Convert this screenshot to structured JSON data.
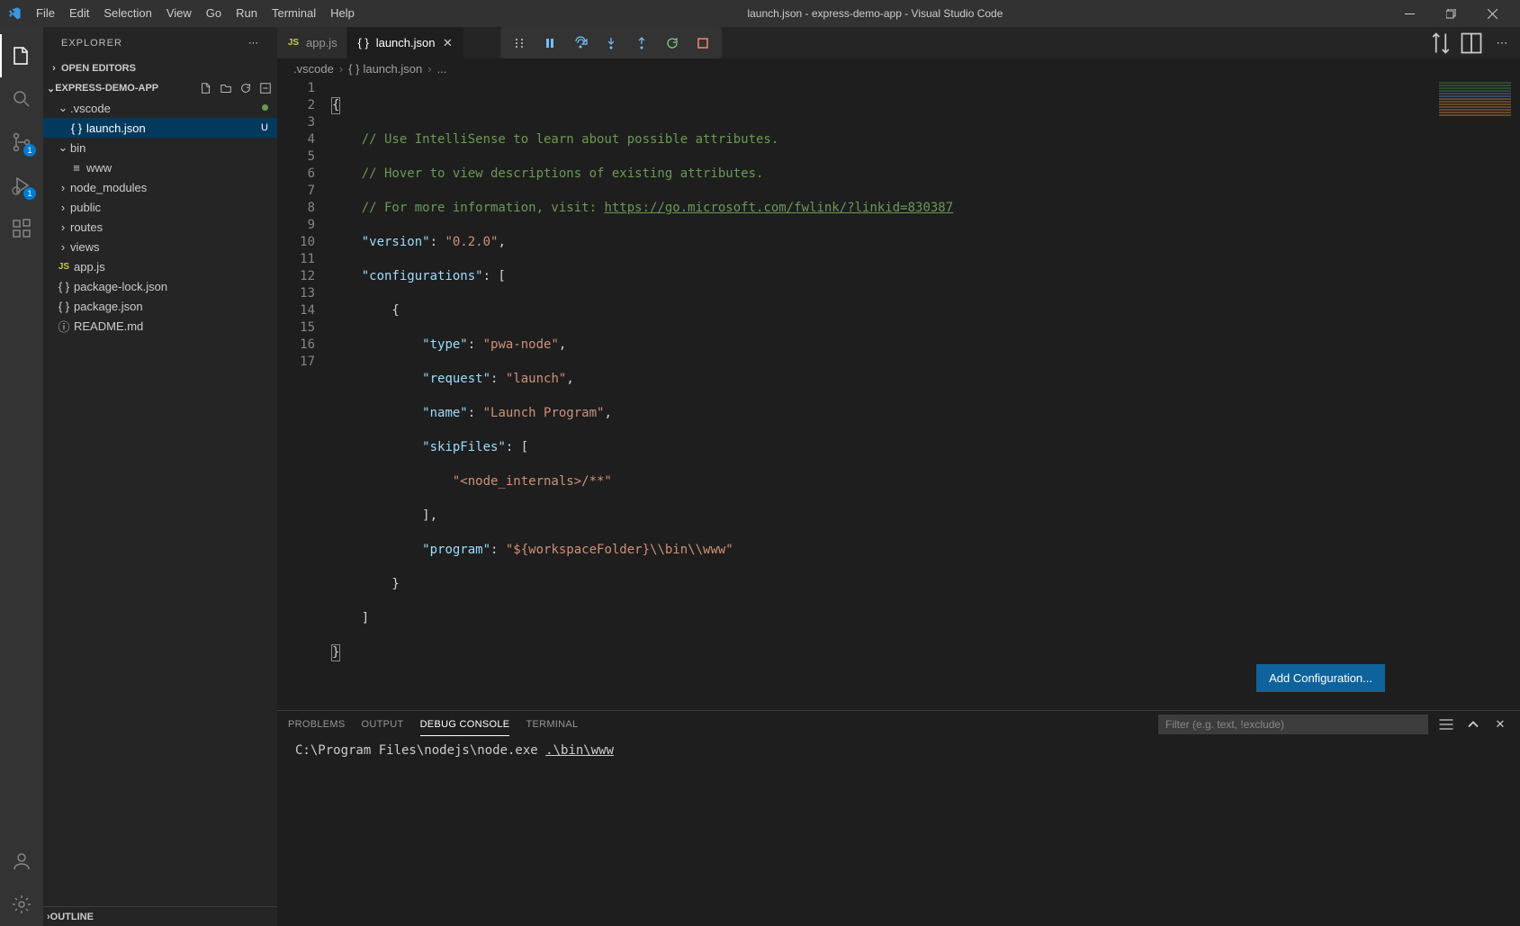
{
  "window": {
    "title": "launch.json - express-demo-app - Visual Studio Code"
  },
  "menu": [
    "File",
    "Edit",
    "Selection",
    "View",
    "Go",
    "Run",
    "Terminal",
    "Help"
  ],
  "activity": {
    "scm_badge": "1",
    "debug_badge": "1"
  },
  "sidebar": {
    "title": "EXPLORER",
    "open_editors": "OPEN EDITORS",
    "project": "EXPRESS-DEMO-APP",
    "outline": "OUTLINE",
    "tree": {
      "vscode": ".vscode",
      "launch": "launch.json",
      "launch_status": "U",
      "bin": "bin",
      "www": "www",
      "node_modules": "node_modules",
      "public": "public",
      "routes": "routes",
      "views": "views",
      "appjs": "app.js",
      "pkglock": "package-lock.json",
      "pkg": "package.json",
      "readme": "README.md"
    }
  },
  "tabs": {
    "appjs": "app.js",
    "launch": "launch.json"
  },
  "breadcrumbs": {
    "b1": ".vscode",
    "b2": "launch.json",
    "b3": "..."
  },
  "editor": {
    "lines": [
      "1",
      "2",
      "3",
      "4",
      "5",
      "6",
      "7",
      "8",
      "9",
      "10",
      "11",
      "12",
      "13",
      "14",
      "15",
      "16",
      "17"
    ],
    "l1": "{",
    "l2c": "    // Use IntelliSense to learn about possible attributes.",
    "l3c": "    // Hover to view descriptions of existing attributes.",
    "l4c1": "    // For more information, visit: ",
    "l4link": "https://go.microsoft.com/fwlink/?linkid=830387",
    "l5k": "\"version\"",
    "l5v": "\"0.2.0\"",
    "l6k": "\"configurations\"",
    "l8k": "\"type\"",
    "l8v": "\"pwa-node\"",
    "l9k": "\"request\"",
    "l9v": "\"launch\"",
    "l10k": "\"name\"",
    "l10v": "\"Launch Program\"",
    "l11k": "\"skipFiles\"",
    "l12v": "\"<node_internals>/**\"",
    "l14k": "\"program\"",
    "l14v": "\"${workspaceFolder}\\\\bin\\\\www\"",
    "add_config": "Add Configuration..."
  },
  "panel": {
    "tabs": {
      "problems": "PROBLEMS",
      "output": "OUTPUT",
      "debug": "DEBUG CONSOLE",
      "terminal": "TERMINAL"
    },
    "filter_placeholder": "Filter (e.g. text, !exclude)",
    "line_path": "C:\\Program Files\\nodejs\\node.exe ",
    "line_arg": ".\\bin\\www"
  }
}
